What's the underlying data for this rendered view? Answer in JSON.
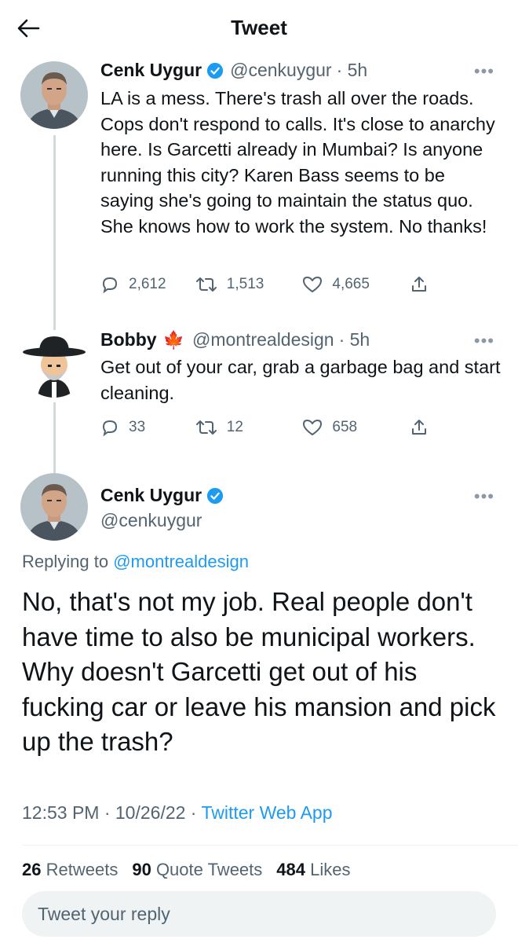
{
  "header": {
    "title": "Tweet",
    "back_icon": "arrow-left-icon"
  },
  "thread": [
    {
      "name": "Cenk Uygur",
      "verified": true,
      "handle": "@cenkuygur",
      "time": "· 5h",
      "text": "LA is a mess. There's trash all over the roads. Cops don't respond to calls. It's close to anarchy here. Is Garcetti already in Mumbai? Is anyone running this city? Karen Bass seems to be saying she's going to maintain the status quo. She knows how to work the system. No thanks!",
      "replies": "2,612",
      "retweets": "1,513",
      "likes": "4,665"
    },
    {
      "name": "Bobby",
      "name_emoji": "🍁",
      "handle": "@montrealdesign",
      "time": "· 5h",
      "text": "Get out of your car, grab a garbage bag and start cleaning.",
      "replies": "33",
      "retweets": "12",
      "likes": "658"
    }
  ],
  "main_tweet": {
    "name": "Cenk Uygur",
    "verified": true,
    "handle": "@cenkuygur",
    "replying_prefix": "Replying to",
    "replying_to": "@montrealdesign",
    "text": "No, that's not my job. Real people don't have time to also be municipal workers. Why doesn't Garcetti get out of his fucking car or leave his mansion and pick up the trash?",
    "timestamp": "12:53 PM · 10/26/22 · ",
    "source": "Twitter Web App",
    "stats": {
      "retweets_count": "26",
      "retweets_label": "Retweets",
      "quotes_count": "90",
      "quotes_label": "Quote Tweets",
      "likes_count": "484",
      "likes_label": "Likes"
    }
  },
  "reply": {
    "placeholder": "Tweet your reply"
  },
  "colors": {
    "accent": "#1d9bf0",
    "text": "#0f1419",
    "secondary": "#536471"
  }
}
